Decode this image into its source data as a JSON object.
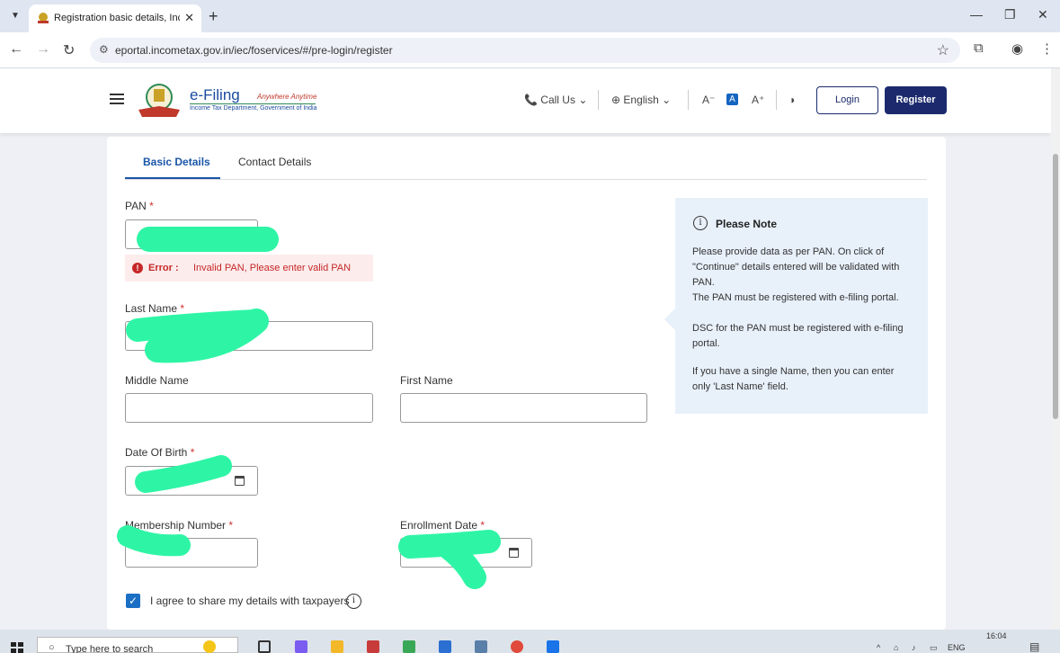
{
  "browser": {
    "tab_title": "Registration basic details, Income",
    "url": "eportal.incometax.gov.in/iec/foservices/#/pre-login/register"
  },
  "header": {
    "logo_title": "e-Filing",
    "logo_tagline": "Anywhere Anytime",
    "logo_subtitle": "Income Tax Department, Government of India",
    "call_us": "Call Us",
    "language": "English",
    "font_decrease": "A⁻",
    "font_normal": "A",
    "font_increase": "A⁺",
    "login_label": "Login",
    "register_label": "Register"
  },
  "tabs": {
    "basic": "Basic Details",
    "contact": "Contact Details"
  },
  "form": {
    "pan_label": "PAN",
    "required_mark": "*",
    "error_prefix": "Error :",
    "error_message": "Invalid PAN, Please enter valid PAN",
    "last_name_label": "Last Name",
    "middle_name_label": "Middle Name",
    "first_name_label": "First Name",
    "dob_label": "Date Of Birth",
    "membership_label": "Membership Number",
    "enrollment_label": "Enrollment Date",
    "agree_text": "I agree to share my details with taxpayers"
  },
  "note": {
    "title": "Please Note",
    "para1": "Please provide data as per PAN. On click of \"Continue\" details entered will be validated with PAN.",
    "para2": "The PAN must be registered with e-filing portal.",
    "para3": "DSC for the PAN must be registered with e-filing portal.",
    "para4": "If you have a single Name, then you can enter only 'Last Name' field."
  },
  "taskbar": {
    "search_placeholder": "Type here to search",
    "lang": "ENG",
    "time": "16:04"
  },
  "colors": {
    "primary": "#1c2a6d",
    "accent_blue": "#1a56a8",
    "error_red": "#c62828",
    "note_bg": "#e8f0fa",
    "redaction": "#2ef5a5"
  }
}
